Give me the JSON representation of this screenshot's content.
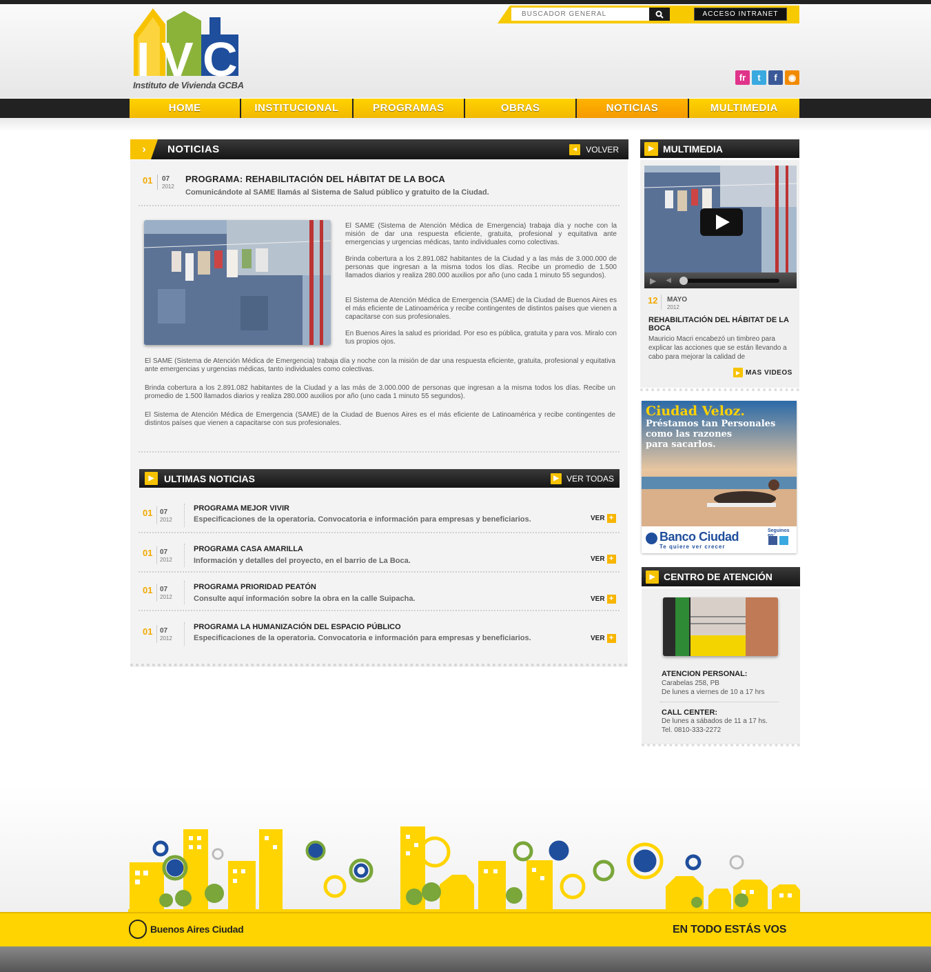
{
  "header": {
    "logo_letters": "IVC",
    "logo_text": "Instituto de Vivienda GCBA",
    "search_placeholder": "BUSCADOR GENERAL",
    "intranet_label": "ACCESO INTRANET",
    "social": [
      {
        "icon": "flickr-icon",
        "glyph": "fr",
        "color": "#e0338a"
      },
      {
        "icon": "twitter-icon",
        "glyph": "t",
        "color": "#39a9e0"
      },
      {
        "icon": "facebook-icon",
        "glyph": "f",
        "color": "#3b5998"
      },
      {
        "icon": "rss-icon",
        "glyph": "◉",
        "color": "#f28a00"
      }
    ]
  },
  "nav": {
    "items": [
      "HOME",
      "INSTITUCIONAL",
      "PROGRAMAS",
      "OBRAS",
      "NOTICIAS",
      "MULTIMEDIA"
    ],
    "active": "NOTICIAS"
  },
  "news": {
    "section_title": "NOTICIAS",
    "back_label": "VOLVER",
    "day": "01",
    "month": "07",
    "year": "2012",
    "title": "PROGRAMA: REHABILITACIÓN DEL HÁBITAT DE LA BOCA",
    "subtitle": "Comunicándote al SAME llamás al Sistema de Salud público y gratuito de la Ciudad.",
    "side_paragraphs": [
      "El SAME (Sistema de Atención Médica de Emergencia) trabaja día y noche con la misión de dar una respuesta eficiente, gratuita, profesional y equitativa ante emergencias y urgencias médicas, tanto individuales como colectivas.",
      "Brinda cobertura a los 2.891.082 habitantes de la Ciudad y a las más de 3.000.000 de personas que ingresan a la misma todos los días. Recibe un promedio de 1.500 llamados diarios y realiza 280.000 auxilios por año (uno cada 1 minuto 55 segundos).",
      "El Sistema de Atención Médica de Emergencia (SAME) de la Ciudad de Buenos Aires es el más eficiente de Latinoamérica y recibe contingentes de distintos países que vienen a capacitarse con sus profesionales.",
      "En Buenos Aires la salud es prioridad. Por eso es pública, gratuita y para vos. Miralo con tus propios ojos."
    ],
    "full_paragraphs": [
      "El SAME (Sistema de Atención Médica de Emergencia) trabaja día y noche con la misión de dar una respuesta eficiente, gratuita, profesional y equitativa ante emergencias y urgencias médicas, tanto individuales como colectivas.",
      "Brinda cobertura a los 2.891.082 habitantes de la Ciudad y a las más de 3.000.000 de personas que ingresan a la misma todos los días. Recibe un promedio de 1.500 llamados diarios y realiza 280.000 auxilios por año (uno cada 1 minuto 55 segundos).",
      "El Sistema de Atención Médica de Emergencia (SAME) de la Ciudad de Buenos Aires es el más eficiente de Latinoamérica y recibe contingentes de distintos países que vienen a capacitarse con sus profesionales."
    ]
  },
  "latest": {
    "title": "ULTIMAS NOTICIAS",
    "see_all": "VER TODAS",
    "ver_label": "VER",
    "items": [
      {
        "day": "01",
        "month": "07",
        "year": "2012",
        "title": "PROGRAMA MEJOR VIVIR",
        "desc": "Especificaciones de la operatoria. Convocatoria e información para empresas y beneficiarios."
      },
      {
        "day": "01",
        "month": "07",
        "year": "2012",
        "title": "PROGRAMA CASA AMARILLA",
        "desc": "Información y detalles del proyecto, en el barrio de La Boca."
      },
      {
        "day": "01",
        "month": "07",
        "year": "2012",
        "title": "PROGRAMA PRIORIDAD PEATÓN",
        "desc": "Consulte aquí información sobre la obra en la calle Suipacha."
      },
      {
        "day": "01",
        "month": "07",
        "year": "2012",
        "title": "PROGRAMA LA HUMANIZACIÓN DEL ESPACIO PÚBLICO",
        "desc": "Especificaciones de la operatoria. Convocatoria e información para empresas y beneficiarios."
      }
    ]
  },
  "multimedia": {
    "title": "MULTIMEDIA",
    "day": "12",
    "month": "MAYO",
    "year": "2012",
    "video_title": "REHABILITACIÓN DEL HÁBITAT DE LA BOCA",
    "video_desc": "Mauricio Macri encabezó un timbreo para explicar las acciones que se están llevando a cabo para mejorar la calidad de",
    "more_label": "MAS VIDEOS"
  },
  "ad": {
    "headline": "Ciudad Veloz.",
    "tagline_1": "Préstamos tan Personales",
    "tagline_2": "como las razones",
    "tagline_3": "para sacarlos.",
    "bank": "Banco Ciudad",
    "bank_slogan": "Te quiere ver crecer",
    "follow": "Seguinos en:"
  },
  "attention": {
    "title": "CENTRO DE ATENCIÓN",
    "personal_label": "ATENCION PERSONAL:",
    "personal_line1": "Carabelas 258, PB",
    "personal_line2": "De lunes a viernes de 10 a 17 hrs",
    "callcenter_label": "CALL CENTER:",
    "callcenter_line1": "De lunes a sábados de 11 a 17 hs.",
    "callcenter_line2": "Tel. 0810-333-2272"
  },
  "footer": {
    "city_label": "Buenos Aires Ciudad",
    "slogan": "EN TODO ESTÁS VOS"
  },
  "colors": {
    "accent": "#ffd200",
    "accent_active": "#f59a00",
    "dark": "#1c1c1c"
  }
}
